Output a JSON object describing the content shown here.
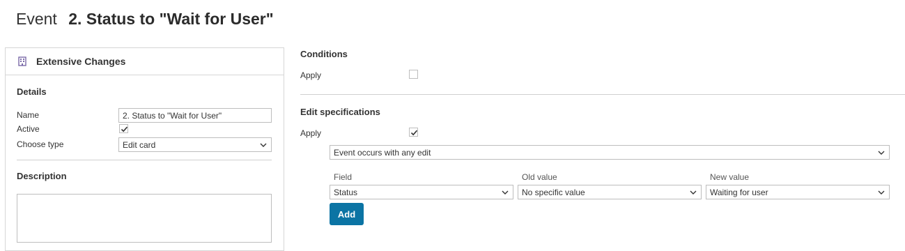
{
  "page": {
    "title_prefix": "Event",
    "title_name": "2. Status to \"Wait for User\""
  },
  "left_panel": {
    "header_icon": "building-icon",
    "header_title": "Extensive Changes",
    "details_title": "Details",
    "name_label": "Name",
    "name_value": "2. Status to \"Wait for User\"",
    "active_label": "Active",
    "active_checked": true,
    "type_label": "Choose type",
    "type_value": "Edit card",
    "description_title": "Description",
    "description_value": ""
  },
  "conditions": {
    "title": "Conditions",
    "apply_label": "Apply",
    "apply_checked": false
  },
  "edit_specs": {
    "title": "Edit specifications",
    "apply_label": "Apply",
    "apply_checked": true,
    "occurs_value": "Event occurs with any edit",
    "columns": {
      "field": "Field",
      "old": "Old value",
      "new": "New value"
    },
    "row": {
      "field": "Status",
      "old": "No specific value",
      "new": "Waiting for user"
    },
    "add_label": "Add"
  },
  "colors": {
    "accent": "#0b74a4",
    "icon": "#7a6aa8"
  }
}
